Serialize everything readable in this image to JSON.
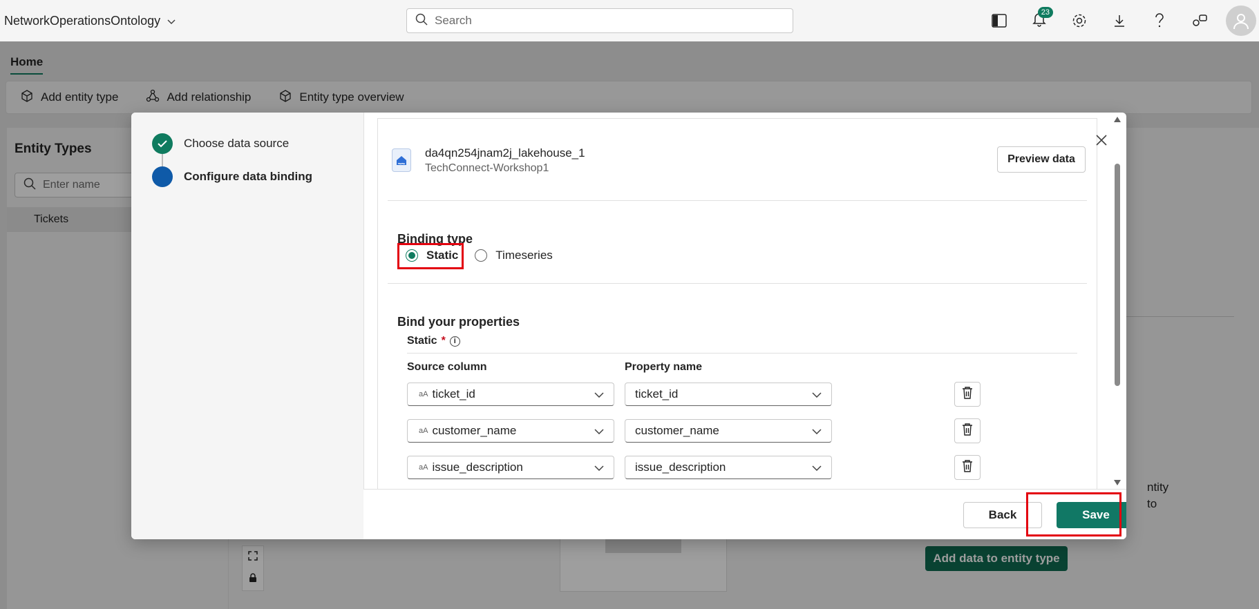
{
  "topbar": {
    "workspace_name": "NetworkOperationsOntology",
    "search_placeholder": "Search",
    "notification_count": "23"
  },
  "ribbon": {
    "tab_home": "Home",
    "add_entity_type": "Add entity type",
    "add_relationship": "Add relationship",
    "entity_type_overview": "Entity type overview"
  },
  "left_panel": {
    "title": "Entity Types",
    "search_placeholder": "Enter name",
    "items": [
      "Tickets"
    ]
  },
  "right_panel": {
    "partial_text_line1": "ntity",
    "partial_text_line2": "to",
    "add_data_button": "Add data to entity type"
  },
  "dialog": {
    "steps": [
      {
        "label": "Choose data source",
        "status": "complete"
      },
      {
        "label": "Configure data binding",
        "status": "current"
      }
    ],
    "source": {
      "name": "da4qn254jnam2j_lakehouse_1",
      "workspace": "TechConnect-Workshop1",
      "preview_button": "Preview data"
    },
    "binding_type": {
      "title": "Binding type",
      "options": [
        "Static",
        "Timeseries"
      ],
      "selected": "Static"
    },
    "bind_properties": {
      "title": "Bind your properties",
      "group_label": "Static",
      "required_marker": "*",
      "source_column_header": "Source column",
      "property_name_header": "Property name",
      "type_badge": "aA",
      "rows": [
        {
          "source": "ticket_id",
          "property": "ticket_id"
        },
        {
          "source": "customer_name",
          "property": "customer_name"
        },
        {
          "source": "issue_description",
          "property": "issue_description"
        }
      ]
    },
    "footer": {
      "back_button": "Back",
      "save_button": "Save"
    }
  },
  "colors": {
    "accent": "#117865",
    "step_current": "#0f5aa8",
    "highlight": "#e3000f"
  }
}
